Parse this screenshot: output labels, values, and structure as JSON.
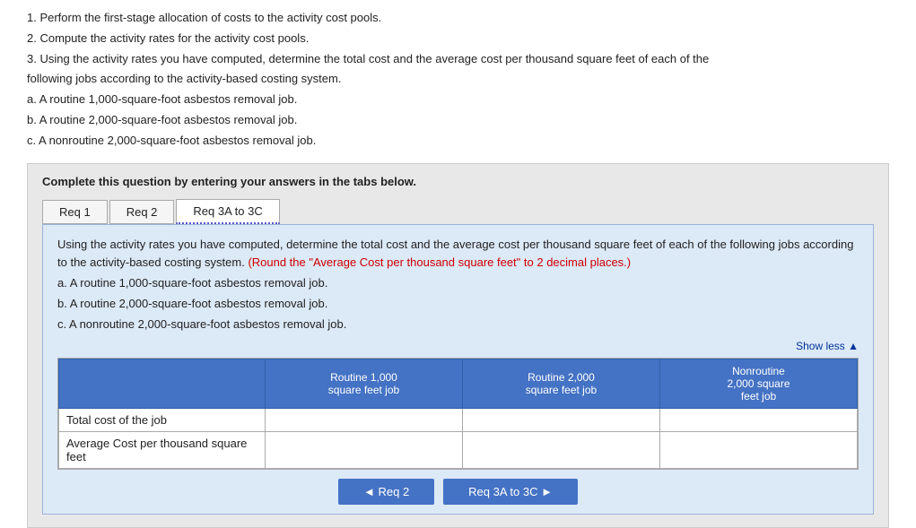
{
  "instructions": {
    "line1": "1. Perform the first-stage allocation of costs to the activity cost pools.",
    "line2": "2. Compute the activity rates for the activity cost pools.",
    "line3": "3. Using the activity rates you have computed, determine the total cost and the average cost per thousand square feet of each of the",
    "line3b": "following jobs according to the activity-based costing system.",
    "line4": "a. A routine 1,000-square-foot asbestos removal job.",
    "line5": "b. A routine 2,000-square-foot asbestos removal job.",
    "line6": "c. A nonroutine 2,000-square-foot asbestos removal job."
  },
  "questionBox": {
    "bold_instruction": "Complete this question by entering your answers in the tabs below."
  },
  "tabs": [
    {
      "id": "req1",
      "label": "Req 1",
      "active": false
    },
    {
      "id": "req2",
      "label": "Req 2",
      "active": false
    },
    {
      "id": "req3a3c",
      "label": "Req 3A to 3C",
      "active": true
    }
  ],
  "tabContent": {
    "description_part1": "Using the activity rates you have computed, determine the total cost and the average cost per thousand square feet of each",
    "description_part2": "of the following jobs according to the activity-based costing system.",
    "highlight": "(Round the \"Average Cost per thousand square feet\" to 2 decimal places.)",
    "line_a": "a. A routine 1,000-square-foot asbestos removal job.",
    "line_b": "b. A routine 2,000-square-foot asbestos removal job.",
    "line_c": "c. A nonroutine 2,000-square-foot asbestos removal job.",
    "show_less": "Show less ▲"
  },
  "table": {
    "headers": {
      "col1": "",
      "col2_line1": "Routine 1,000",
      "col2_line2": "square feet job",
      "col3_line1": "Routine 2,000",
      "col3_line2": "square feet job",
      "col4_line1": "Nonroutine",
      "col4_line2": "2,000 square",
      "col4_line3": "feet job"
    },
    "rows": [
      {
        "label": "Total cost of the job",
        "col2": "",
        "col3": "",
        "col4": ""
      },
      {
        "label": "Average Cost per thousand square feet",
        "col2": "",
        "col3": "",
        "col4": ""
      }
    ]
  },
  "navButtons": {
    "prev_label": "◄ Req 2",
    "next_label": "Req 3A to 3C ►"
  }
}
